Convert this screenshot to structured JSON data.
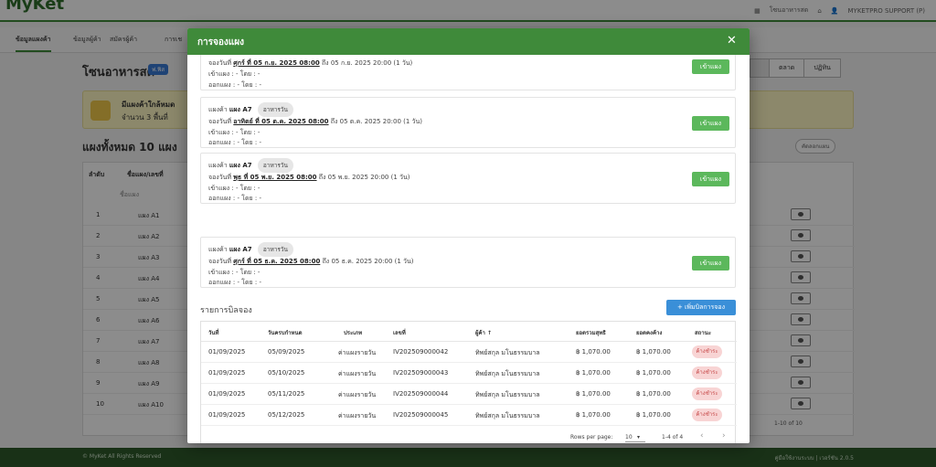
{
  "app": {
    "brand": "MyKet",
    "header_links": [
      "โซนอาหารสด",
      "MYKETPRO SUPPORT (P)"
    ],
    "nav_tabs": [
      "ข้อมูลแผงค้า",
      "ข้อมูลผู้ค้า",
      "สมัครผู้ค้า",
      "การเช"
    ],
    "page_title": "โซนอาหารสด",
    "page_badge": "ฟ.ฟิส",
    "view_tabs": [
      "",
      "ตลาด",
      "ปฏิทิน"
    ],
    "notice_title": "มีแผงค้าใกล้หมด",
    "notice_text": "จำนวน 3 พื้นที่",
    "section_title": "แผงทั้งหมด 10 แผง",
    "section_button": "คัดลอกแผน",
    "bg_headers": [
      "ลำดับ",
      "ชื่อแผง/เลขที่"
    ],
    "bg_filter_placeholder": "ชื่อแผง",
    "bg_rows": [
      {
        "no": "1",
        "name": "แผง A1"
      },
      {
        "no": "2",
        "name": "แผง A2"
      },
      {
        "no": "3",
        "name": "แผง A3"
      },
      {
        "no": "4",
        "name": "แผง A4"
      },
      {
        "no": "5",
        "name": "แผง A5"
      },
      {
        "no": "6",
        "name": "แผง A6"
      },
      {
        "no": "7",
        "name": "แผง A7"
      },
      {
        "no": "8",
        "name": "แผง A8"
      },
      {
        "no": "9",
        "name": "แผง A9"
      },
      {
        "no": "10",
        "name": "แผง A10"
      }
    ],
    "bg_pager": "1-10 of 10",
    "footer_left": "© MyKet All Rights Reserved",
    "footer_right": "คู่มือใช้งานระบบ | เวอร์ชัน 2.0.5"
  },
  "modal": {
    "title": "การจองแผง",
    "close": "✕",
    "bookings": [
      {
        "stall_prefix": "",
        "stall": "",
        "chip": "",
        "booking_prefix": "จองวันที่",
        "booking_date": "ศุกร์ ที่ 05 ก.ย. 2025 08:00",
        "booking_suffix": "ถึง 05 ก.ย. 2025 20:00 (1 วัน)",
        "enter_line": "เข้าแผง : - โดย : -",
        "exit_line": "ออกแผง : - โดย : -",
        "button": "เข้าแผง"
      },
      {
        "stall_prefix": "แผงค้า",
        "stall": "แผง A7",
        "chip": "อาหารวัน",
        "booking_prefix": "จองวันที่",
        "booking_date": "อาทิตย์ ที่ 05 ต.ค. 2025 08:00",
        "booking_suffix": "ถึง 05 ต.ค. 2025 20:00 (1 วัน)",
        "enter_line": "เข้าแผง : - โดย : -",
        "exit_line": "ออกแผง : - โดย : -",
        "button": "เข้าแผง"
      },
      {
        "stall_prefix": "แผงค้า",
        "stall": "แผง A7",
        "chip": "อาหารวัน",
        "booking_prefix": "จองวันที่",
        "booking_date": "พุธ ที่ 05 พ.ย. 2025 08:00",
        "booking_suffix": "ถึง 05 พ.ย. 2025 20:00 (1 วัน)",
        "enter_line": "เข้าแผง : - โดย : -",
        "exit_line": "ออกแผง : - โดย : -",
        "button": "เข้าแผง"
      },
      {
        "stall_prefix": "แผงค้า",
        "stall": "แผง A7",
        "chip": "อาหารวัน",
        "booking_prefix": "จองวันที่",
        "booking_date": "ศุกร์ ที่ 05 ธ.ค. 2025 08:00",
        "booking_suffix": "ถึง 05 ธ.ค. 2025 20:00 (1 วัน)",
        "enter_line": "เข้าแผง : - โดย : -",
        "exit_line": "ออกแผง : - โดย : -",
        "button": "เข้าแผง"
      }
    ],
    "invoice_title": "รายการบิลจอง",
    "add_button": "+ เพิ่มบิลการจอง",
    "table_headers": [
      "วันที่",
      "วันครบกำหนด",
      "ประเภท",
      "เลขที่",
      "ผู้ค้า ↑",
      "ยอดรวมสุทธิ",
      "ยอดคงค้าง",
      "สถานะ"
    ],
    "rows": [
      [
        "01/09/2025",
        "05/09/2025",
        "ค่าแผงรายวัน",
        "IV202509000042",
        "ทิพย์สกุล มโนธรรมบาล",
        "฿ 1,070.00",
        "฿ 1,070.00",
        "ค้างชำระ"
      ],
      [
        "01/09/2025",
        "05/10/2025",
        "ค่าแผงรายวัน",
        "IV202509000043",
        "ทิพย์สกุล มโนธรรมบาล",
        "฿ 1,070.00",
        "฿ 1,070.00",
        "ค้างชำระ"
      ],
      [
        "01/09/2025",
        "05/11/2025",
        "ค่าแผงรายวัน",
        "IV202509000044",
        "ทิพย์สกุล มโนธรรมบาล",
        "฿ 1,070.00",
        "฿ 1,070.00",
        "ค้างชำระ"
      ],
      [
        "01/09/2025",
        "05/12/2025",
        "ค่าแผงรายวัน",
        "IV202509000045",
        "ทิพย์สกุล มโนธรรมบาล",
        "฿ 1,070.00",
        "฿ 1,070.00",
        "ค้างชำระ"
      ]
    ],
    "rows_per_page_label": "Rows per page:",
    "rows_per_page_value": "10",
    "range": "1-4 of 4",
    "prev": "‹",
    "next": "›"
  }
}
